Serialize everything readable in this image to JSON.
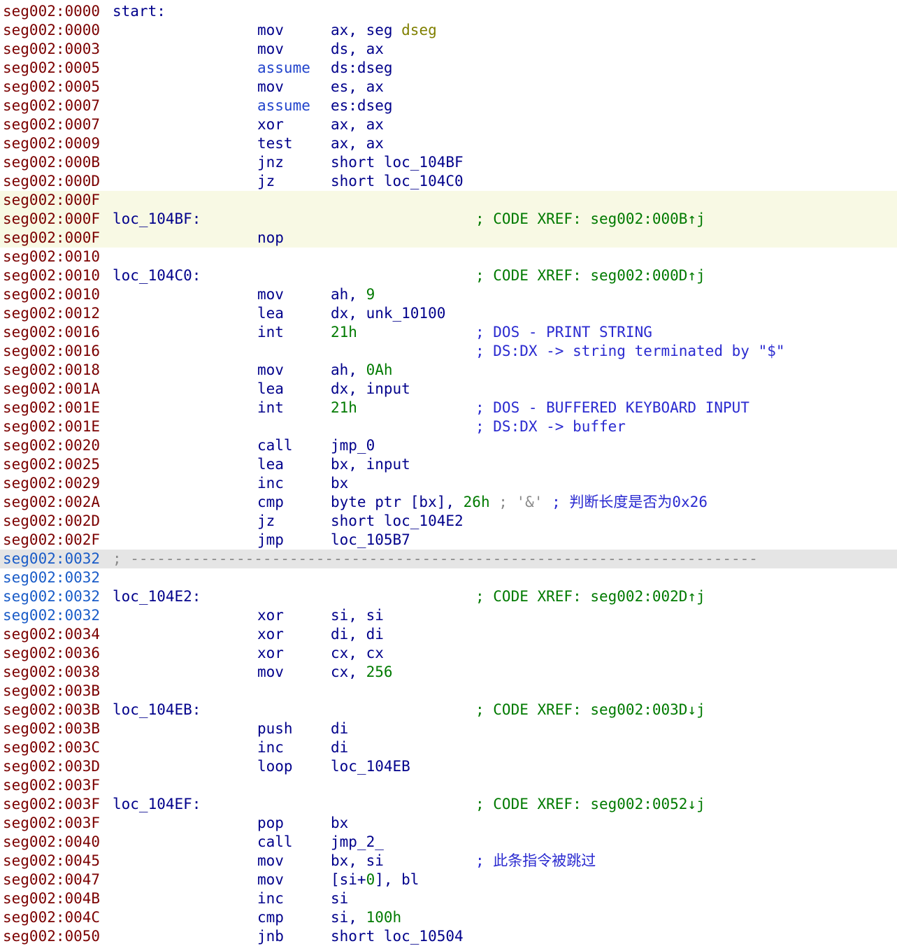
{
  "listing": {
    "lines": [
      {
        "addr": "seg002:0000",
        "label": "start:"
      },
      {
        "addr": "seg002:0000",
        "mnem": "mov",
        "ops": [
          [
            "ax, seg ",
            "reg"
          ],
          [
            "dseg",
            "seg"
          ]
        ]
      },
      {
        "addr": "seg002:0003",
        "mnem": "mov",
        "ops": [
          [
            "ds, ax",
            "reg"
          ]
        ]
      },
      {
        "addr": "seg002:0005",
        "mnem": "assume",
        "assume": true,
        "ops": [
          [
            "ds:dseg",
            "reg"
          ]
        ]
      },
      {
        "addr": "seg002:0005",
        "mnem": "mov",
        "ops": [
          [
            "es, ax",
            "reg"
          ]
        ]
      },
      {
        "addr": "seg002:0007",
        "mnem": "assume",
        "assume": true,
        "ops": [
          [
            "es:dseg",
            "reg"
          ]
        ]
      },
      {
        "addr": "seg002:0007",
        "mnem": "xor",
        "ops": [
          [
            "ax, ax",
            "reg"
          ]
        ]
      },
      {
        "addr": "seg002:0009",
        "mnem": "test",
        "ops": [
          [
            "ax, ax",
            "reg"
          ]
        ]
      },
      {
        "addr": "seg002:000B",
        "mnem": "jnz",
        "ops": [
          [
            "short loc_104BF",
            "ref"
          ]
        ]
      },
      {
        "addr": "seg002:000D",
        "mnem": "jz",
        "ops": [
          [
            "short loc_104C0",
            "ref"
          ]
        ]
      },
      {
        "addr": "seg002:000F",
        "hl": "yellow"
      },
      {
        "addr": "seg002:000F",
        "label": "loc_104BF:",
        "comment": "; CODE XREF: seg002:000B↑j",
        "hl": "yellow"
      },
      {
        "addr": "seg002:000F",
        "mnem": "nop",
        "hl": "yellow"
      },
      {
        "addr": "seg002:0010"
      },
      {
        "addr": "seg002:0010",
        "label": "loc_104C0:",
        "comment": "; CODE XREF: seg002:000D↑j"
      },
      {
        "addr": "seg002:0010",
        "mnem": "mov",
        "ops": [
          [
            "ah, ",
            "reg"
          ],
          [
            "9",
            "num"
          ]
        ]
      },
      {
        "addr": "seg002:0012",
        "mnem": "lea",
        "ops": [
          [
            "dx, unk_10100",
            "reg"
          ]
        ]
      },
      {
        "addr": "seg002:0016",
        "mnem": "int",
        "ops": [
          [
            "21h",
            "num"
          ]
        ],
        "comment": "; DOS - PRINT STRING",
        "comment_style": "blue"
      },
      {
        "addr": "seg002:0016",
        "comment": "; DS:DX -> string terminated by \"$\"",
        "comment_style": "blue"
      },
      {
        "addr": "seg002:0018",
        "mnem": "mov",
        "ops": [
          [
            "ah, ",
            "reg"
          ],
          [
            "0Ah",
            "num"
          ]
        ]
      },
      {
        "addr": "seg002:001A",
        "mnem": "lea",
        "ops": [
          [
            "dx, input",
            "reg"
          ]
        ]
      },
      {
        "addr": "seg002:001E",
        "mnem": "int",
        "ops": [
          [
            "21h",
            "num"
          ]
        ],
        "comment": "; DOS - BUFFERED KEYBOARD INPUT",
        "comment_style": "blue"
      },
      {
        "addr": "seg002:001E",
        "comment": "; DS:DX -> buffer",
        "comment_style": "blue"
      },
      {
        "addr": "seg002:0020",
        "mnem": "call",
        "ops": [
          [
            "jmp_0",
            "ref"
          ]
        ]
      },
      {
        "addr": "seg002:0025",
        "mnem": "lea",
        "ops": [
          [
            "bx, input",
            "reg"
          ]
        ]
      },
      {
        "addr": "seg002:0029",
        "mnem": "inc",
        "ops": [
          [
            "bx",
            "reg"
          ]
        ]
      },
      {
        "addr": "seg002:002A",
        "mnem": "cmp",
        "ops": [
          [
            "byte ptr [bx], ",
            "reg"
          ],
          [
            "26h",
            "num"
          ],
          [
            " ; ",
            "gray"
          ],
          [
            "'&'",
            "gray"
          ],
          [
            " ; 判断长度是否为0x26",
            "blue"
          ]
        ]
      },
      {
        "addr": "seg002:002D",
        "mnem": "jz",
        "ops": [
          [
            "short loc_104E2",
            "ref"
          ]
        ]
      },
      {
        "addr": "seg002:002F",
        "mnem": "jmp",
        "ops": [
          [
            "loc_105B7",
            "ref"
          ]
        ]
      },
      {
        "addr": "seg002:0032",
        "addr_blue": true,
        "separator": "; -----------------------------------------------------------------------",
        "hl": "grey"
      },
      {
        "addr": "seg002:0032",
        "addr_blue": true
      },
      {
        "addr": "seg002:0032",
        "addr_blue": true,
        "label": "loc_104E2:",
        "comment": "; CODE XREF: seg002:002D↑j"
      },
      {
        "addr": "seg002:0032",
        "addr_blue": true,
        "mnem": "xor",
        "ops": [
          [
            "si, si",
            "reg"
          ]
        ]
      },
      {
        "addr": "seg002:0034",
        "mnem": "xor",
        "ops": [
          [
            "di, di",
            "reg"
          ]
        ]
      },
      {
        "addr": "seg002:0036",
        "mnem": "xor",
        "ops": [
          [
            "cx, cx",
            "reg"
          ]
        ]
      },
      {
        "addr": "seg002:0038",
        "mnem": "mov",
        "ops": [
          [
            "cx, ",
            "reg"
          ],
          [
            "256",
            "num"
          ]
        ]
      },
      {
        "addr": "seg002:003B"
      },
      {
        "addr": "seg002:003B",
        "label": "loc_104EB:",
        "comment": "; CODE XREF: seg002:003D↓j"
      },
      {
        "addr": "seg002:003B",
        "mnem": "push",
        "ops": [
          [
            "di",
            "reg"
          ]
        ]
      },
      {
        "addr": "seg002:003C",
        "mnem": "inc",
        "ops": [
          [
            "di",
            "reg"
          ]
        ]
      },
      {
        "addr": "seg002:003D",
        "mnem": "loop",
        "ops": [
          [
            "loc_104EB",
            "ref"
          ]
        ]
      },
      {
        "addr": "seg002:003F"
      },
      {
        "addr": "seg002:003F",
        "label": "loc_104EF:",
        "comment": "; CODE XREF: seg002:0052↓j"
      },
      {
        "addr": "seg002:003F",
        "mnem": "pop",
        "ops": [
          [
            "bx",
            "reg"
          ]
        ]
      },
      {
        "addr": "seg002:0040",
        "mnem": "call",
        "ops": [
          [
            "jmp_2_",
            "ref"
          ]
        ]
      },
      {
        "addr": "seg002:0045",
        "mnem": "mov",
        "ops": [
          [
            "bx, si",
            "reg"
          ]
        ],
        "comment": "; 此条指令被跳过",
        "comment_style": "blue"
      },
      {
        "addr": "seg002:0047",
        "mnem": "mov",
        "ops": [
          [
            "[si+",
            "reg"
          ],
          [
            "0",
            "num"
          ],
          [
            "], bl",
            "reg"
          ]
        ]
      },
      {
        "addr": "seg002:004B",
        "mnem": "inc",
        "ops": [
          [
            "si",
            "reg"
          ]
        ]
      },
      {
        "addr": "seg002:004C",
        "mnem": "cmp",
        "ops": [
          [
            "si, ",
            "reg"
          ],
          [
            "100h",
            "num"
          ]
        ]
      },
      {
        "addr": "seg002:0050",
        "mnem": "jnb",
        "ops": [
          [
            "short loc_10504",
            "ref"
          ]
        ]
      }
    ]
  }
}
